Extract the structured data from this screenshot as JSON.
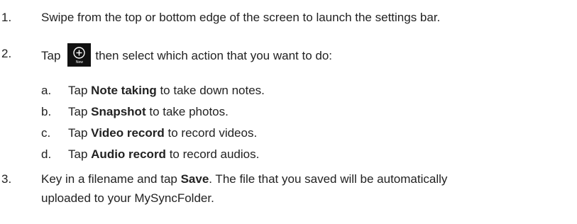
{
  "steps": [
    {
      "number": "1.",
      "text": "Swipe from the top or bottom edge of the screen to launch the settings bar."
    },
    {
      "number": "2.",
      "text_before": "Tap",
      "icon": {
        "name": "plus-circle-icon",
        "caption": "New"
      },
      "text_after": "then select which action that you want to do:",
      "substeps": [
        {
          "letter": "a.",
          "pre": "Tap",
          "bold": "Note taking",
          "post": "to take down notes."
        },
        {
          "letter": "b.",
          "pre": "Tap",
          "bold": "Snapshot",
          "post": "to take photos."
        },
        {
          "letter": "c.",
          "pre": "Tap",
          "bold": "Video record",
          "post": "to record videos."
        },
        {
          "letter": "d.",
          "pre": "Tap",
          "bold": "Audio record",
          "post": "to record audios."
        }
      ]
    },
    {
      "number": "3.",
      "pre": "Key in a filename and tap",
      "bold": "Save",
      "post": ". The file that you saved will be automatically",
      "line2": "uploaded to your MySyncFolder."
    }
  ]
}
